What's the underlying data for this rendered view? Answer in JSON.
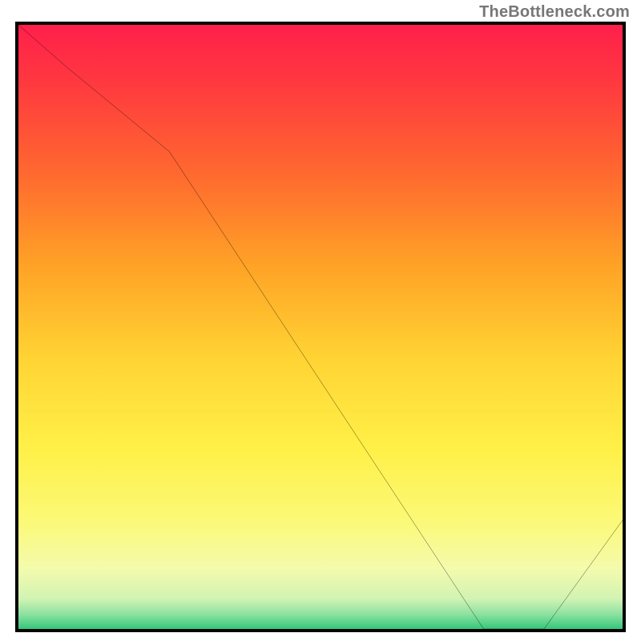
{
  "watermark": "TheBottleneck.com",
  "chart_data": {
    "type": "line",
    "x": [
      0.0,
      0.08,
      0.25,
      0.77,
      0.87,
      1.0
    ],
    "series": [
      {
        "name": "curve",
        "values": [
          1.0,
          0.93,
          0.79,
          0.0,
          0.0,
          0.18
        ]
      }
    ],
    "xlim": [
      0,
      1
    ],
    "ylim": [
      0,
      1
    ],
    "xlabel": "",
    "ylabel": "",
    "title": "",
    "grid": false,
    "annotation": {
      "text": "",
      "x": 0.82,
      "y": 0.015,
      "color": "#c03027"
    },
    "gradient_stops": [
      {
        "offset": 0.0,
        "color": "#ff1f4b"
      },
      {
        "offset": 0.1,
        "color": "#ff3a3f"
      },
      {
        "offset": 0.25,
        "color": "#ff6a2f"
      },
      {
        "offset": 0.4,
        "color": "#ffa326"
      },
      {
        "offset": 0.55,
        "color": "#ffd333"
      },
      {
        "offset": 0.7,
        "color": "#fff047"
      },
      {
        "offset": 0.82,
        "color": "#fbf976"
      },
      {
        "offset": 0.9,
        "color": "#f4fbac"
      },
      {
        "offset": 0.95,
        "color": "#d1f3b3"
      },
      {
        "offset": 0.975,
        "color": "#8fe2a0"
      },
      {
        "offset": 1.0,
        "color": "#34c77c"
      }
    ]
  }
}
